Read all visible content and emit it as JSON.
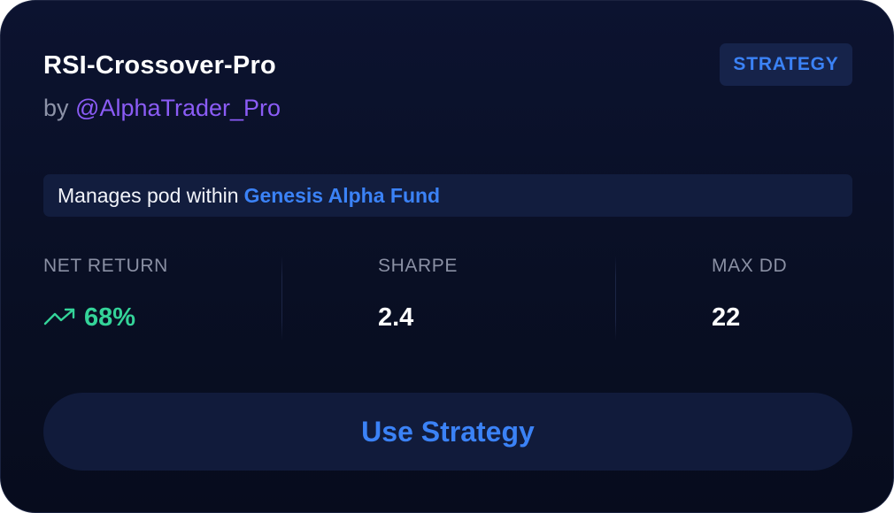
{
  "strategy": {
    "name": "RSI-Crossover-Pro",
    "by_prefix": "by",
    "author": "@AlphaTrader_Pro",
    "badge": "STRATEGY"
  },
  "pod": {
    "text": "Manages pod within",
    "fund_name": "Genesis Alpha Fund"
  },
  "stats": [
    {
      "label": "NET RETURN",
      "value": "68%",
      "icon": "trending-up-icon"
    },
    {
      "label": "SHARPE",
      "value": "2.4"
    },
    {
      "label": "MAX DD",
      "value": "22"
    }
  ],
  "cta": {
    "label": "Use Strategy"
  },
  "colors": {
    "accent_blue": "#3b82f6",
    "author_purple": "#8b5cf6",
    "positive_green": "#34d399",
    "card_background": "#0a1128"
  }
}
